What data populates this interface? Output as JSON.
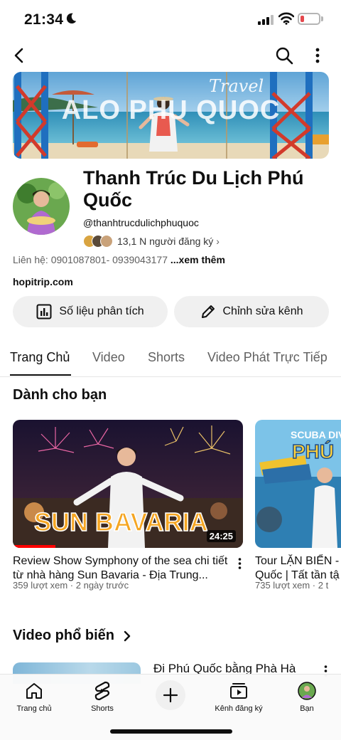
{
  "status_bar": {
    "time": "21:34",
    "icons": [
      "moon-icon",
      "signal-icon",
      "wifi-icon",
      "battery-icon"
    ]
  },
  "app_bar": {
    "icons": [
      "back-icon",
      "search-icon",
      "more-vert-icon"
    ]
  },
  "banner": {
    "title": "ALO PHU QUOC",
    "tag": "Travel"
  },
  "channel": {
    "name": "Thanh Trúc Du Lịch Phú Quốc",
    "handle": "@thanhtrucdulichphuquoc",
    "subscribers": "13,1 N người đăng ký",
    "contact": "Liên hệ: 0901087801- 0939043177",
    "contact_more": "...xem thêm",
    "website": "hopitrip.com"
  },
  "actions": {
    "analytics": "Số liệu phân tích",
    "edit": "Chỉnh sửa kênh"
  },
  "tabs": [
    "Trang Chủ",
    "Video",
    "Shorts",
    "Video Phát Trực Tiếp"
  ],
  "for_you": {
    "title": "Dành cho bạn",
    "videos": [
      {
        "thumb_text": "SUN BAVARIA",
        "duration": "24:25",
        "title": "Review Show Symphony of the sea chi tiết từ nhà hàng Sun Bavaria - Địa Trung...",
        "meta": "359 lượt xem · 2 ngày trước"
      },
      {
        "thumb_text": "PHÚ",
        "thumb_tag": "SCUBA DIV",
        "title": "Tour LẶN BIỂN -",
        "title2": "Quốc | Tất tần tậ",
        "meta": "735 lượt xem · 2 t"
      }
    ]
  },
  "popular": {
    "title": "Video phổ biến",
    "first_title": "Đi Phú Quốc bằng Phà Hà"
  },
  "nav": [
    {
      "label": "Trang chủ",
      "icon": "home-icon"
    },
    {
      "label": "Shorts",
      "icon": "shorts-icon"
    },
    {
      "label": "",
      "icon": "add-icon"
    },
    {
      "label": "Kênh đăng ký",
      "icon": "subscriptions-icon"
    },
    {
      "label": "Bạn",
      "icon": "profile-avatar-icon"
    }
  ],
  "colors": {
    "accent_red": "#ff0000",
    "chip_bg": "#f0f0f0",
    "secondary_text": "#606060"
  }
}
